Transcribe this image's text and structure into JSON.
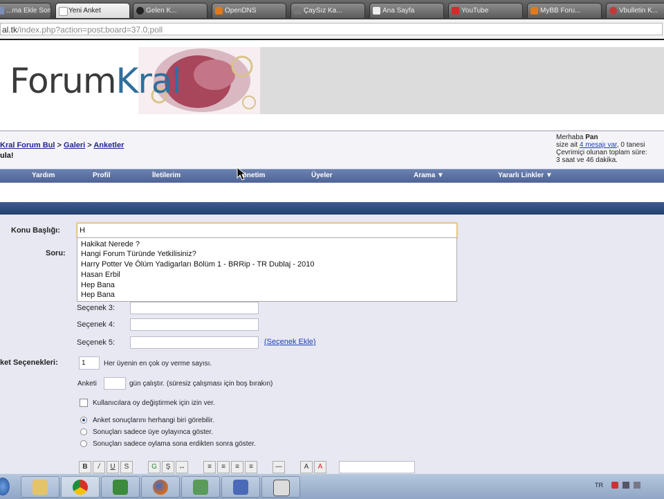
{
  "browser": {
    "tabs": [
      {
        "label": "...ma Ekle Sonu..."
      },
      {
        "label": "Yeni Anket"
      },
      {
        "label": "Gelen K..."
      },
      {
        "label": "OpenDNS"
      },
      {
        "label": "ÇaySız Ka..."
      },
      {
        "label": "Ana Sayfa"
      },
      {
        "label": "YouTube"
      },
      {
        "label": "MyBB Foru..."
      },
      {
        "label": "Vbulletin K..."
      }
    ],
    "url_host": "al.tk",
    "url_path": "/index.php?action=post;board=37.0;poll"
  },
  "header": {
    "logo_text_a": "Forum",
    "logo_text_b": "Kral"
  },
  "breadcrumb": {
    "items": [
      "Kral Forum Bul",
      "Galeri",
      "Anketler"
    ],
    "separator": ">",
    "page_name": "ula!"
  },
  "userbox": {
    "greeting": "Merhaba ",
    "username": "Pan",
    "line2_pre": "size ait ",
    "line2_link": "4 mesajı var",
    "line2_post": ", 0 tanesi",
    "line3": "Çevrimiçi olunan toplam süre:",
    "line4": "3 saat ve 46 dakika."
  },
  "nav": {
    "items": [
      "Yardım",
      "Profil",
      "İletilerim",
      "Yönetim",
      "Üyeler",
      "Arama ▼",
      "Yararlı Linkler ▼"
    ]
  },
  "form": {
    "subject_label": "Konu Başlığı:",
    "subject_value": "H",
    "question_label": "Soru:",
    "autocomplete": [
      "Hakikat Nerede ?",
      "Hangi Forum Türünde Yetkilisiniz?",
      "Harry Potter Ve Ölüm Yadigarları Bölüm 1 - BRRip - TR Dublaj - 2010",
      "Hasan Erbil",
      "Hep Bana",
      "Hep Bana"
    ],
    "options": [
      {
        "label": "Seçenek 3:"
      },
      {
        "label": "Seçenek 4:"
      },
      {
        "label": "Seçenek 5:"
      }
    ],
    "add_option": "(Seçenek Ekle)",
    "poll_options_label": "ket Seçenekleri:",
    "max_votes_value": "1",
    "max_votes_text": "Her üyenin en çok oy verme sayısı.",
    "run_prefix": "Anketi",
    "run_suffix": "gün çalıştır. (süresiz çalışması için boş bırakın)",
    "change_vote_text": "Kullanıcılara oy değiştirmek için izin ver.",
    "visibility": [
      {
        "label": "Anket sonuçlarını herhangi biri görebilir.",
        "selected": true
      },
      {
        "label": "Sonuçları sadece üye oylayınca göster.",
        "selected": false
      },
      {
        "label": "Sonuçları sadece oylama sona erdikten sonra göster.",
        "selected": false
      }
    ]
  },
  "taskbar": {
    "tray_lang": "TR"
  },
  "colors": {
    "nav_blue": "#5a6fa2",
    "dark_blue": "#2f4d80",
    "link_blue": "#1a3fb0",
    "focus_orange": "#e6b84d"
  }
}
